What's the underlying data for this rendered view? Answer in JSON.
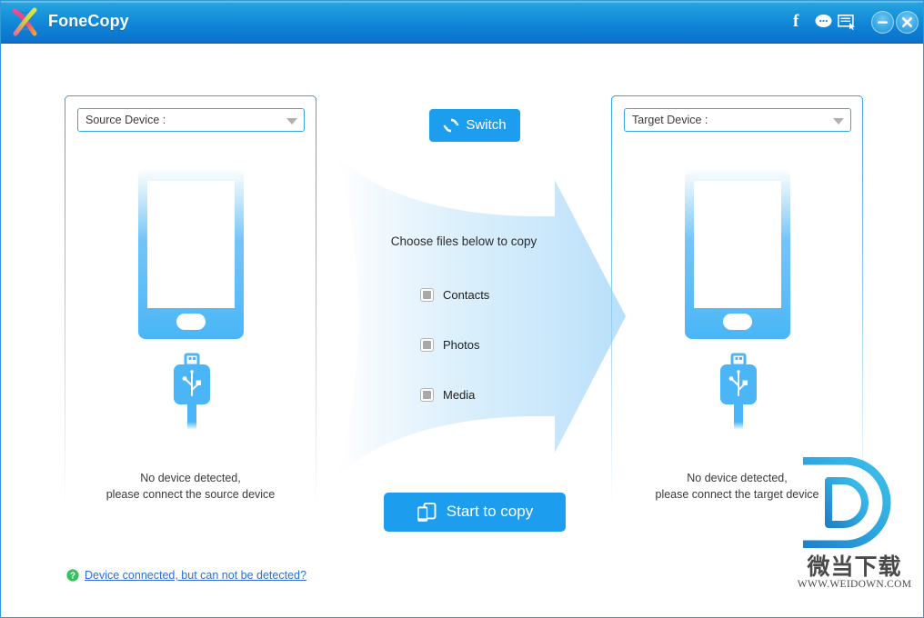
{
  "window": {
    "title": "FoneCopy",
    "logo_icon": "dna-helix-logo-icon",
    "titlebar_icons": [
      {
        "name": "facebook-icon",
        "glyph": "f"
      },
      {
        "name": "chat-bubble-icon",
        "glyph": ""
      },
      {
        "name": "feedback-form-icon",
        "glyph": ""
      }
    ],
    "minimize_label": "Minimize",
    "close_label": "Close",
    "accent_color": "#1c9ded",
    "titlebar_color_top": "#2aa7e0",
    "titlebar_color_bottom": "#0a70cd"
  },
  "source_panel": {
    "select_label": "Source Device :",
    "select_icon": "chevron-down-icon",
    "device_icon": "smartphone-icon",
    "usb_icon": "usb-connector-icon",
    "status_line1": "No device detected,",
    "status_line2": "please connect the source device"
  },
  "target_panel": {
    "select_label": "Target Device :",
    "select_icon": "chevron-down-icon",
    "device_icon": "smartphone-icon",
    "usb_icon": "usb-connector-icon",
    "status_line1": "No device detected,",
    "status_line2": "please connect the target device"
  },
  "center": {
    "switch_label": "Switch",
    "switch_icon": "refresh-sync-icon",
    "choose_text": "Choose files below to copy",
    "arrow_icon": "right-arrow-graphic",
    "file_options": [
      {
        "label": "Contacts",
        "checked": false,
        "enabled": false
      },
      {
        "label": "Photos",
        "checked": false,
        "enabled": false
      },
      {
        "label": "Media",
        "checked": false,
        "enabled": false
      }
    ],
    "start_label": "Start to copy",
    "start_icon": "two-devices-icon"
  },
  "footer": {
    "help_icon": "question-mark-circle-icon",
    "help_text": "Device connected, but can not be detected?",
    "help_color": "#2c6fd4"
  },
  "watermark": {
    "logo_icon": "letter-d-logo-icon",
    "chinese_text": "微当下载",
    "url_text": "WWW.WEIDOWN.COM"
  }
}
